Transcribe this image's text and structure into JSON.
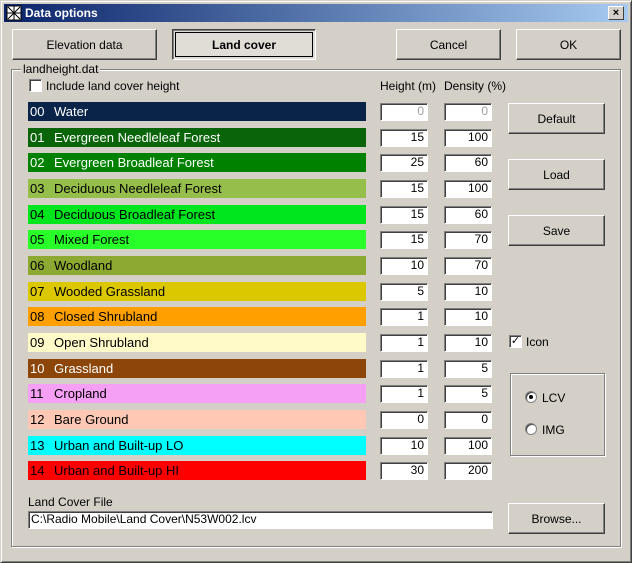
{
  "window": {
    "title": "Data options",
    "close_label": "×"
  },
  "top_buttons": {
    "elevation": "Elevation data",
    "landcover": "Land cover",
    "cancel": "Cancel",
    "ok": "OK"
  },
  "group": {
    "label": "landheight.dat",
    "include_label": "Include land cover height",
    "include_checked": false,
    "height_header": "Height (m)",
    "density_header": "Density (%)"
  },
  "land_covers": [
    {
      "code": "00",
      "name": "Water",
      "color": "#0a2348",
      "text_color": "#ffffff",
      "height": "0",
      "density": "0",
      "disabled": true
    },
    {
      "code": "01",
      "name": "Evergreen Needleleaf Forest",
      "color": "#0a640a",
      "text_color": "#ffffff",
      "height": "15",
      "density": "100",
      "disabled": false
    },
    {
      "code": "02",
      "name": "Evergreen Broadleaf Forest",
      "color": "#008200",
      "text_color": "#ffffff",
      "height": "25",
      "density": "60",
      "disabled": false
    },
    {
      "code": "03",
      "name": "Deciduous Needleleaf Forest",
      "color": "#96be4b",
      "text_color": "#000000",
      "height": "15",
      "density": "100",
      "disabled": false
    },
    {
      "code": "04",
      "name": "Deciduous Broadleaf Forest",
      "color": "#00e61e",
      "text_color": "#000000",
      "height": "15",
      "density": "60",
      "disabled": false
    },
    {
      "code": "05",
      "name": "Mixed Forest",
      "color": "#28ff28",
      "text_color": "#000000",
      "height": "15",
      "density": "70",
      "disabled": false
    },
    {
      "code": "06",
      "name": "Woodland",
      "color": "#8caa32",
      "text_color": "#000000",
      "height": "10",
      "density": "70",
      "disabled": false
    },
    {
      "code": "07",
      "name": "Wooded Grassland",
      "color": "#dcc800",
      "text_color": "#000000",
      "height": "5",
      "density": "10",
      "disabled": false
    },
    {
      "code": "08",
      "name": "Closed Shrubland",
      "color": "#ffa000",
      "text_color": "#000000",
      "height": "1",
      "density": "10",
      "disabled": false
    },
    {
      "code": "09",
      "name": "Open Shrubland",
      "color": "#fffac8",
      "text_color": "#000000",
      "height": "1",
      "density": "10",
      "disabled": false
    },
    {
      "code": "10",
      "name": "Grassland",
      "color": "#8c460a",
      "text_color": "#ffffff",
      "height": "1",
      "density": "5",
      "disabled": false
    },
    {
      "code": "11",
      "name": "Cropland",
      "color": "#f5a0f5",
      "text_color": "#000000",
      "height": "1",
      "density": "5",
      "disabled": false
    },
    {
      "code": "12",
      "name": "Bare Ground",
      "color": "#ffc8b4",
      "text_color": "#000000",
      "height": "0",
      "density": "0",
      "disabled": false
    },
    {
      "code": "13",
      "name": "Urban and Built-up LO",
      "color": "#00ffff",
      "text_color": "#000000",
      "height": "10",
      "density": "100",
      "disabled": false
    },
    {
      "code": "14",
      "name": "Urban and Built-up HI",
      "color": "#ff0000",
      "text_color": "#000000",
      "height": "30",
      "density": "200",
      "disabled": false
    }
  ],
  "side_buttons": {
    "default": "Default",
    "load": "Load",
    "save": "Save"
  },
  "icon_option": {
    "label": "Icon",
    "checked": true
  },
  "format": {
    "lcv_label": "LCV",
    "img_label": "IMG",
    "selected": "LCV"
  },
  "file": {
    "label": "Land Cover File",
    "path": "C:\\Radio Mobile\\Land Cover\\N53W002.lcv",
    "browse_label": "Browse..."
  },
  "icons": {
    "app": "app-icon",
    "close": "close-icon",
    "check": "check-icon"
  }
}
